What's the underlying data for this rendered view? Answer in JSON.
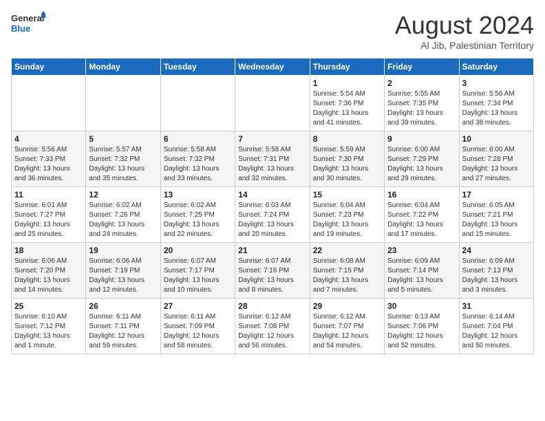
{
  "header": {
    "logo_line1": "General",
    "logo_line2": "Blue",
    "month": "August 2024",
    "location": "Al Jib, Palestinian Territory"
  },
  "days_of_week": [
    "Sunday",
    "Monday",
    "Tuesday",
    "Wednesday",
    "Thursday",
    "Friday",
    "Saturday"
  ],
  "weeks": [
    [
      {
        "day": "",
        "info": ""
      },
      {
        "day": "",
        "info": ""
      },
      {
        "day": "",
        "info": ""
      },
      {
        "day": "",
        "info": ""
      },
      {
        "day": "1",
        "info": "Sunrise: 5:54 AM\nSunset: 7:36 PM\nDaylight: 13 hours\nand 41 minutes."
      },
      {
        "day": "2",
        "info": "Sunrise: 5:55 AM\nSunset: 7:35 PM\nDaylight: 13 hours\nand 39 minutes."
      },
      {
        "day": "3",
        "info": "Sunrise: 5:56 AM\nSunset: 7:34 PM\nDaylight: 13 hours\nand 38 minutes."
      }
    ],
    [
      {
        "day": "4",
        "info": "Sunrise: 5:56 AM\nSunset: 7:33 PM\nDaylight: 13 hours\nand 36 minutes."
      },
      {
        "day": "5",
        "info": "Sunrise: 5:57 AM\nSunset: 7:32 PM\nDaylight: 13 hours\nand 35 minutes."
      },
      {
        "day": "6",
        "info": "Sunrise: 5:58 AM\nSunset: 7:32 PM\nDaylight: 13 hours\nand 33 minutes."
      },
      {
        "day": "7",
        "info": "Sunrise: 5:58 AM\nSunset: 7:31 PM\nDaylight: 13 hours\nand 32 minutes."
      },
      {
        "day": "8",
        "info": "Sunrise: 5:59 AM\nSunset: 7:30 PM\nDaylight: 13 hours\nand 30 minutes."
      },
      {
        "day": "9",
        "info": "Sunrise: 6:00 AM\nSunset: 7:29 PM\nDaylight: 13 hours\nand 29 minutes."
      },
      {
        "day": "10",
        "info": "Sunrise: 6:00 AM\nSunset: 7:28 PM\nDaylight: 13 hours\nand 27 minutes."
      }
    ],
    [
      {
        "day": "11",
        "info": "Sunrise: 6:01 AM\nSunset: 7:27 PM\nDaylight: 13 hours\nand 25 minutes."
      },
      {
        "day": "12",
        "info": "Sunrise: 6:02 AM\nSunset: 7:26 PM\nDaylight: 13 hours\nand 24 minutes."
      },
      {
        "day": "13",
        "info": "Sunrise: 6:02 AM\nSunset: 7:25 PM\nDaylight: 13 hours\nand 22 minutes."
      },
      {
        "day": "14",
        "info": "Sunrise: 6:03 AM\nSunset: 7:24 PM\nDaylight: 13 hours\nand 20 minutes."
      },
      {
        "day": "15",
        "info": "Sunrise: 6:04 AM\nSunset: 7:23 PM\nDaylight: 13 hours\nand 19 minutes."
      },
      {
        "day": "16",
        "info": "Sunrise: 6:04 AM\nSunset: 7:22 PM\nDaylight: 13 hours\nand 17 minutes."
      },
      {
        "day": "17",
        "info": "Sunrise: 6:05 AM\nSunset: 7:21 PM\nDaylight: 13 hours\nand 15 minutes."
      }
    ],
    [
      {
        "day": "18",
        "info": "Sunrise: 6:06 AM\nSunset: 7:20 PM\nDaylight: 13 hours\nand 14 minutes."
      },
      {
        "day": "19",
        "info": "Sunrise: 6:06 AM\nSunset: 7:19 PM\nDaylight: 13 hours\nand 12 minutes."
      },
      {
        "day": "20",
        "info": "Sunrise: 6:07 AM\nSunset: 7:17 PM\nDaylight: 13 hours\nand 10 minutes."
      },
      {
        "day": "21",
        "info": "Sunrise: 6:07 AM\nSunset: 7:16 PM\nDaylight: 13 hours\nand 8 minutes."
      },
      {
        "day": "22",
        "info": "Sunrise: 6:08 AM\nSunset: 7:15 PM\nDaylight: 13 hours\nand 7 minutes."
      },
      {
        "day": "23",
        "info": "Sunrise: 6:09 AM\nSunset: 7:14 PM\nDaylight: 13 hours\nand 5 minutes."
      },
      {
        "day": "24",
        "info": "Sunrise: 6:09 AM\nSunset: 7:13 PM\nDaylight: 13 hours\nand 3 minutes."
      }
    ],
    [
      {
        "day": "25",
        "info": "Sunrise: 6:10 AM\nSunset: 7:12 PM\nDaylight: 13 hours\nand 1 minute."
      },
      {
        "day": "26",
        "info": "Sunrise: 6:11 AM\nSunset: 7:11 PM\nDaylight: 12 hours\nand 59 minutes."
      },
      {
        "day": "27",
        "info": "Sunrise: 6:11 AM\nSunset: 7:09 PM\nDaylight: 12 hours\nand 58 minutes."
      },
      {
        "day": "28",
        "info": "Sunrise: 6:12 AM\nSunset: 7:08 PM\nDaylight: 12 hours\nand 56 minutes."
      },
      {
        "day": "29",
        "info": "Sunrise: 6:12 AM\nSunset: 7:07 PM\nDaylight: 12 hours\nand 54 minutes."
      },
      {
        "day": "30",
        "info": "Sunrise: 6:13 AM\nSunset: 7:06 PM\nDaylight: 12 hours\nand 52 minutes."
      },
      {
        "day": "31",
        "info": "Sunrise: 6:14 AM\nSunset: 7:04 PM\nDaylight: 12 hours\nand 50 minutes."
      }
    ]
  ]
}
